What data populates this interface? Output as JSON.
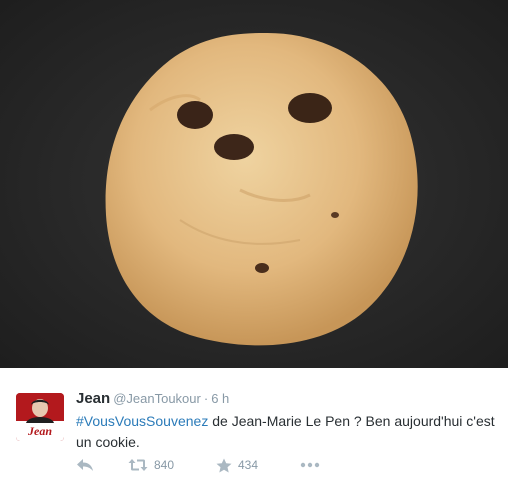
{
  "tweet": {
    "display_name": "Jean",
    "handle": "@JeanToukour",
    "separator": "·",
    "time": "6 h",
    "hashtag": "#VousVousSouvenez",
    "text_rest": " de Jean-Marie Le Pen ? Ben aujourd'hui c'est un cookie.",
    "avatar_label": "Jean",
    "retweets": "840",
    "favorites": "434"
  },
  "icons": {
    "reply": "reply-icon",
    "retweet": "retweet-icon",
    "favorite": "star-icon",
    "more": "more-icon"
  },
  "colors": {
    "hashtag": "#2b7bb9",
    "meta": "#8899a6",
    "avatar_bg": "#b3191d"
  }
}
